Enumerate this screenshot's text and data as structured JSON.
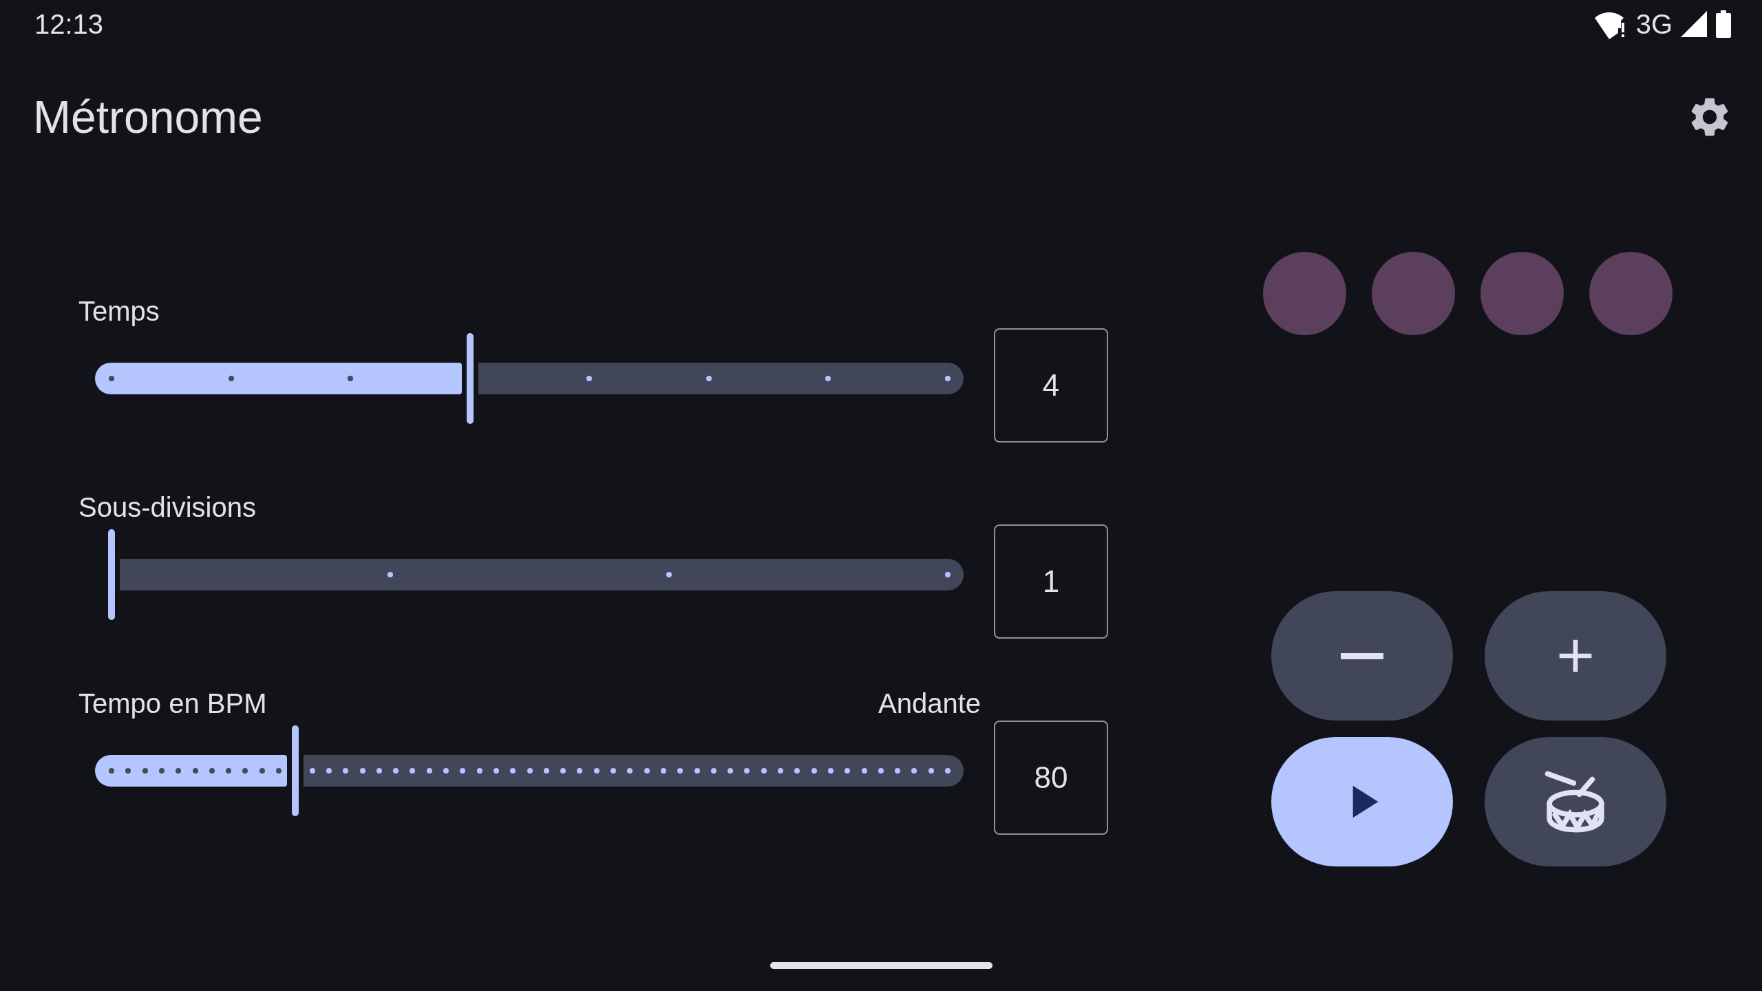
{
  "status_bar": {
    "time": "12:13",
    "network": "3G"
  },
  "app_bar": {
    "title": "Métronome"
  },
  "sliders": [
    {
      "label": "Temps",
      "level": 0.4286,
      "value": "4"
    },
    {
      "label": "Sous-divisions",
      "level": 0,
      "value": "1"
    },
    {
      "label": "Tempo en BPM",
      "tempo_name": "Andante",
      "level": 0.22,
      "value": "80"
    }
  ],
  "beat_indicators": [
    {
      "kind": "beat"
    },
    {
      "kind": "beat"
    },
    {
      "kind": "beat"
    },
    {
      "kind": "beat"
    }
  ],
  "controls": [
    {
      "kind": "minus"
    },
    {
      "kind": "plus"
    },
    {
      "kind": "play"
    },
    {
      "kind": "drum"
    }
  ]
}
